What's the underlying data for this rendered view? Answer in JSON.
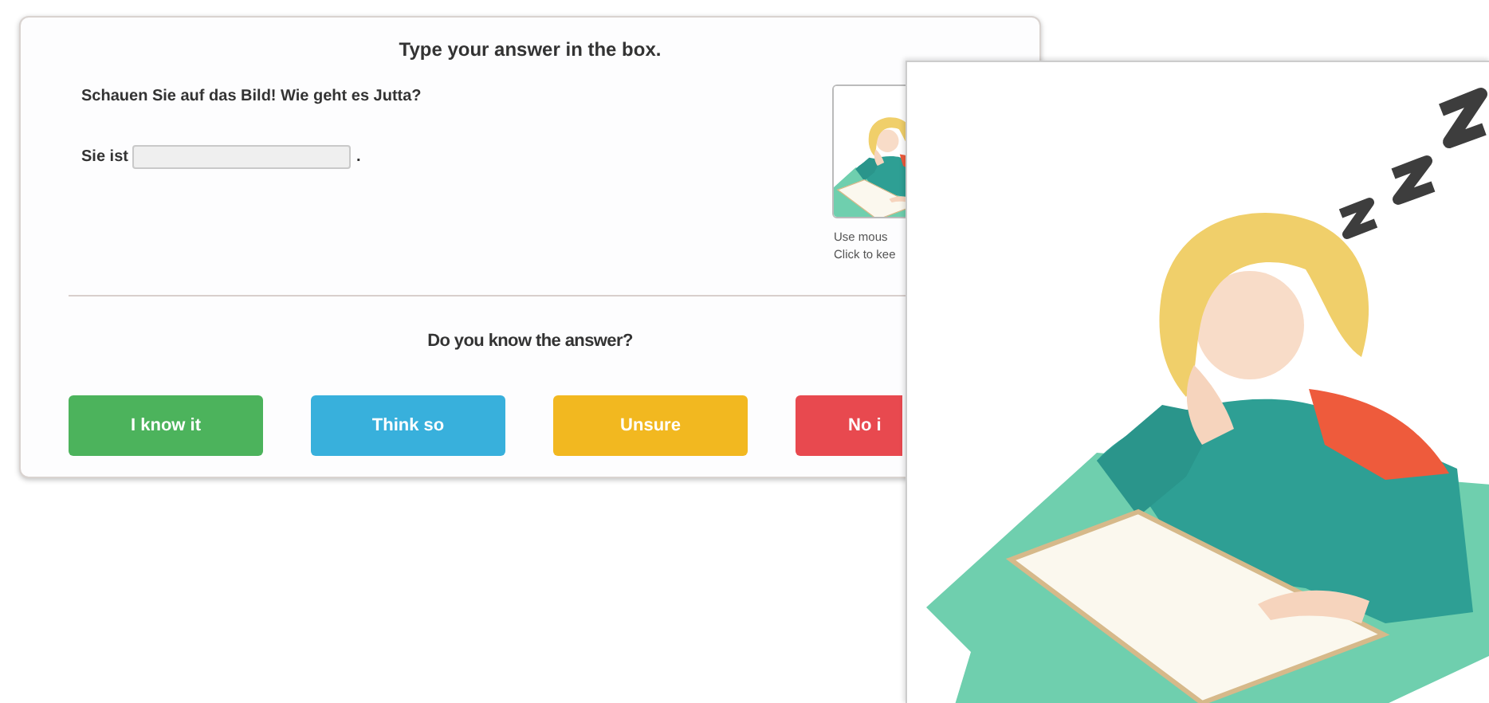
{
  "instruction": "Type your answer in the box.",
  "question": "Schauen Sie auf das Bild! Wie geht es Jutta?",
  "answer": {
    "prefix": "Sie ist",
    "suffix": "."
  },
  "thumbnail": {
    "kind": "picture",
    "caption_lines": [
      "Use mous",
      "Click to kee"
    ]
  },
  "confidence": {
    "prompt": "Do you know the answer?",
    "buttons": [
      {
        "label": "I know it",
        "color": "#4cb35c"
      },
      {
        "label": "Think so",
        "color": "#38b0dc"
      },
      {
        "label": "Unsure",
        "color": "#f2b820"
      },
      {
        "label": "No i",
        "color": "#e8494f"
      }
    ]
  }
}
